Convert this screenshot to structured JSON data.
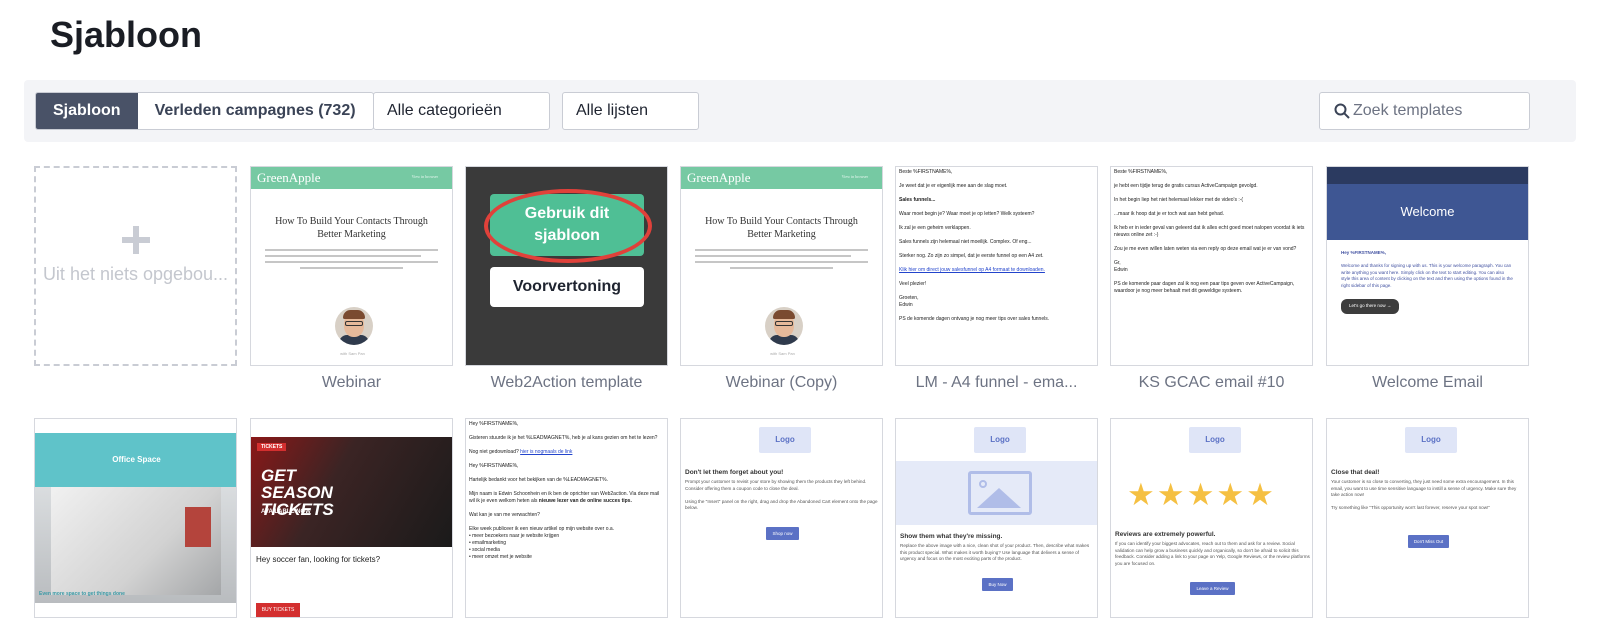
{
  "page": {
    "title": "Sjabloon"
  },
  "toolbar": {
    "tab_templates": "Sjabloon",
    "tab_past": "Verleden campagnes (732)",
    "categories": "Alle categorieën",
    "lists": "Alle lijsten",
    "search_placeholder": "Zoek templates"
  },
  "hover": {
    "use": "Gebruik dit sjabloon",
    "preview": "Voorvertoning"
  },
  "blank": {
    "text": "Uit het niets opgebou..."
  },
  "cards": {
    "webinar": {
      "label": "Webinar",
      "brand": "GreenApple",
      "headline": "How To Build Your Contacts Through Better Marketing"
    },
    "web2action": {
      "label": "Web2Action template"
    },
    "webinar_copy": {
      "label": "Webinar (Copy)",
      "brand": "GreenApple",
      "headline": "How To Build Your Contacts Through Better Marketing"
    },
    "lm_funnel": {
      "label": "LM - A4 funnel - ema..."
    },
    "ks_gcac": {
      "label": "KS GCAC email #10"
    },
    "welcome": {
      "label": "Welcome Email",
      "banner": "Welcome",
      "button": "Let's go there now →"
    }
  },
  "row2": {
    "office": {
      "brand": "Office Space",
      "foot": "Even more space to get things done"
    },
    "tickets": {
      "tag": "TICKETS",
      "title": "GET SEASON TICKETS",
      "sub": "AVAILABLE NOW",
      "heading": "Hey soccer fan, looking for tickets?",
      "button": "BUY TICKETS"
    },
    "lead": {
      "line1": "Hey %FIRSTNAME%,",
      "link": "hier is nogmaals de link"
    },
    "abandoned": {
      "logo": "Logo",
      "heading": "Don't let them forget about you!",
      "button": "Shop now"
    },
    "product": {
      "logo": "Logo",
      "heading": "Show them what they're missing.",
      "button": "Buy Now"
    },
    "reviews": {
      "logo": "Logo",
      "stars": "★★★★★",
      "heading": "Reviews are extremely powerful.",
      "button": "Leave a Review"
    },
    "closedeal": {
      "logo": "Logo",
      "heading": "Close that deal!",
      "button": "Don't Miss Out"
    }
  }
}
